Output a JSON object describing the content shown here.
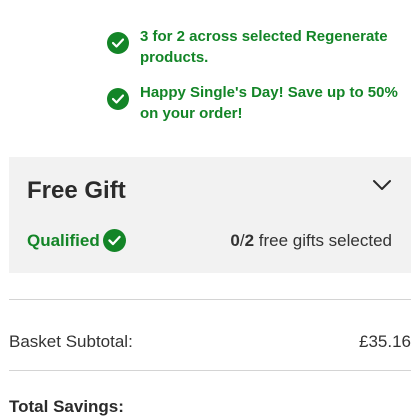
{
  "promotions": [
    {
      "text": "3 for 2 across selected Regenerate products.",
      "icon": "check-circle-icon"
    },
    {
      "text": "Happy Single's Day! Save up to 50% on your order!",
      "icon": "check-circle-icon"
    }
  ],
  "free_gift": {
    "title": "Free Gift",
    "expand_icon": "chevron-down-icon",
    "qualified_label": "Qualified",
    "selected_count": "0",
    "separator": "/",
    "total_count": "2",
    "selected_suffix": " free gifts selected"
  },
  "summary": {
    "subtotal_label": "Basket Subtotal:",
    "subtotal_value": "£35.16",
    "savings_label": "Total Savings:"
  },
  "colors": {
    "accent_green": "#138527",
    "panel_bg": "#f2f2f2",
    "divider": "#d4d4d4"
  }
}
